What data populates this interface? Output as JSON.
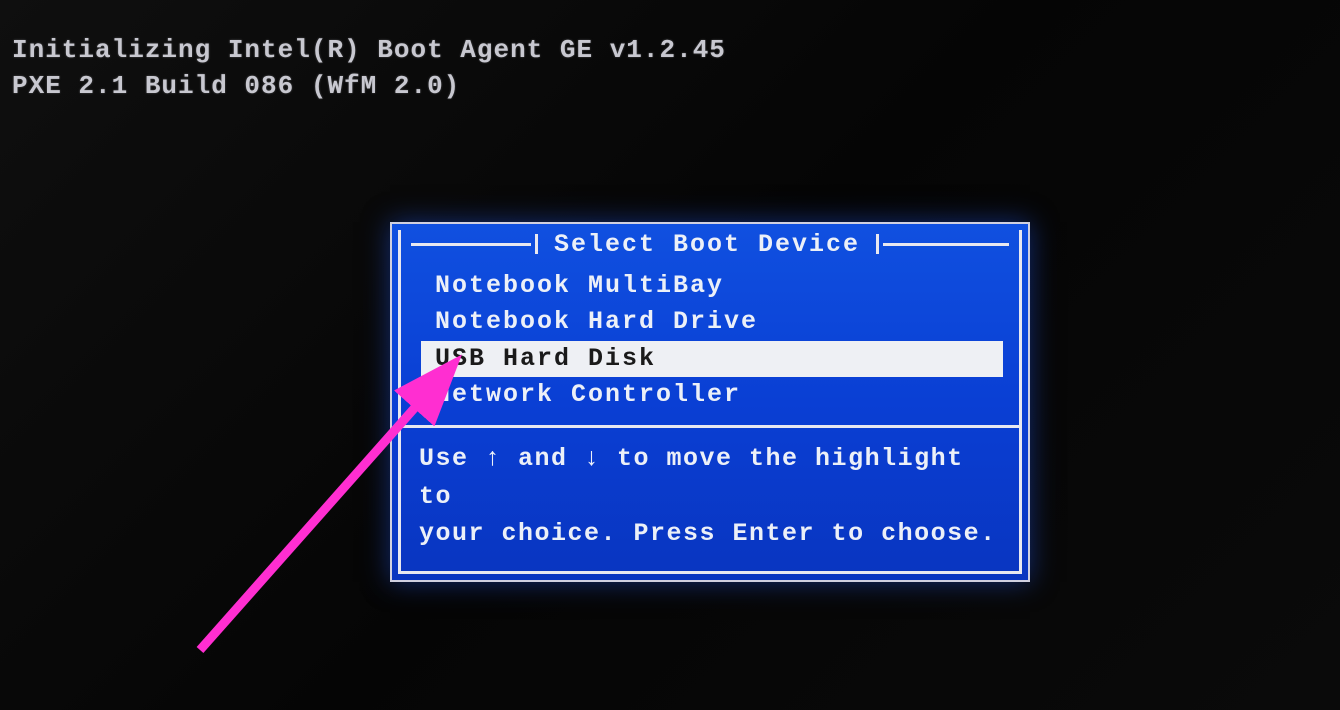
{
  "boot": {
    "line1": "Initializing Intel(R) Boot Agent GE v1.2.45",
    "line2": "PXE 2.1 Build 086 (WfM 2.0)"
  },
  "menu": {
    "title": "Select Boot Device",
    "items": [
      {
        "label": "Notebook MultiBay",
        "selected": false
      },
      {
        "label": "Notebook Hard Drive",
        "selected": false
      },
      {
        "label": "USB Hard Disk",
        "selected": true
      },
      {
        "label": "Network Controller",
        "selected": false
      }
    ],
    "help_line1": "Use ↑ and ↓ to move the highlight to",
    "help_line2": "your choice.  Press Enter to choose."
  },
  "annotation": {
    "color": "#ff2ed1"
  }
}
